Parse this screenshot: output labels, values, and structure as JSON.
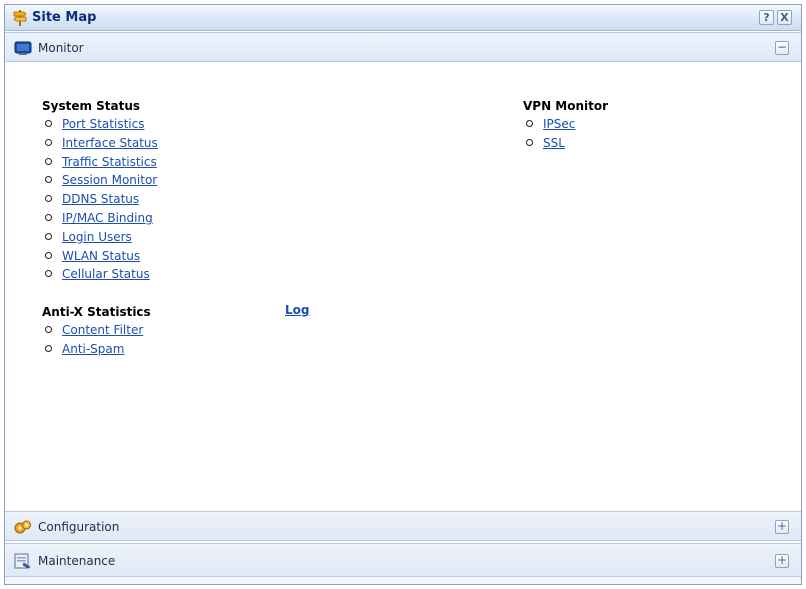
{
  "window": {
    "title": "Site Map",
    "help_btn": "?",
    "close_btn": "X"
  },
  "sections": {
    "monitor": {
      "label": "Monitor",
      "toggle": "−"
    },
    "configuration": {
      "label": "Configuration",
      "toggle": "+"
    },
    "maintenance": {
      "label": "Maintenance",
      "toggle": "+"
    }
  },
  "monitor": {
    "system_status": {
      "title": "System Status",
      "links": [
        "Port Statistics",
        "Interface Status",
        "Traffic Statistics",
        "Session Monitor",
        "DDNS Status",
        "IP/MAC Binding",
        "Login Users",
        "WLAN Status",
        "Cellular Status"
      ]
    },
    "vpn_monitor": {
      "title": "VPN Monitor",
      "links": [
        "IPSec",
        "SSL"
      ]
    },
    "anti_x": {
      "title": "Anti-X Statistics",
      "links": [
        "Content Filter",
        "Anti-Spam"
      ]
    },
    "log_link": "Log"
  },
  "colors": {
    "link": "#1c4fb0",
    "title": "#0a2f7a",
    "header_bg": "#dfe8f6"
  }
}
